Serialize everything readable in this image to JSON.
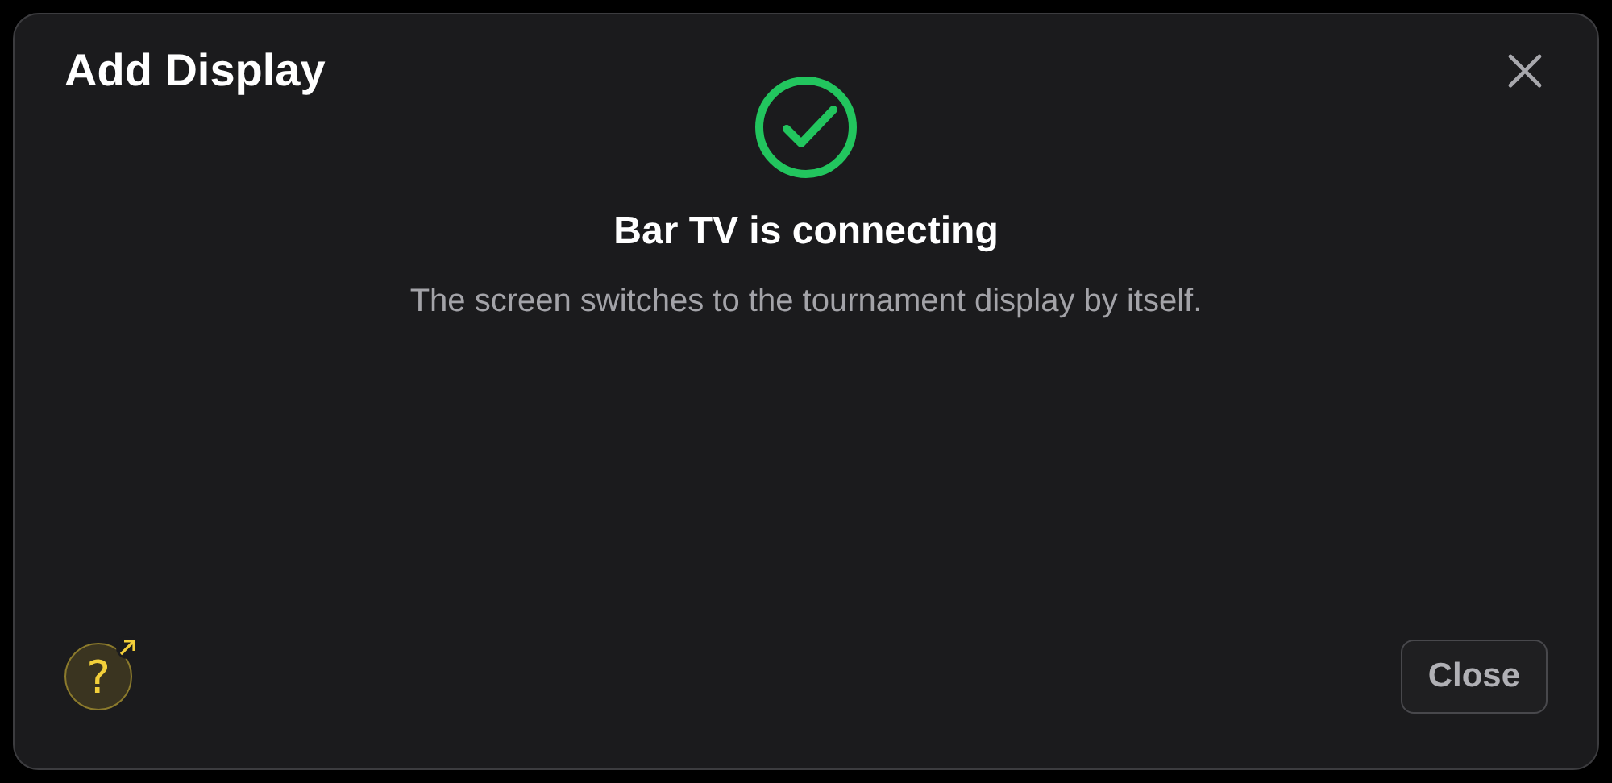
{
  "dialog": {
    "title": "Add Display",
    "status": {
      "kind": "success",
      "heading": "Bar TV is connecting",
      "message": "The screen switches to the tournament display by itself."
    },
    "help": {
      "symbol": "?"
    },
    "buttons": [
      "Close"
    ]
  }
}
